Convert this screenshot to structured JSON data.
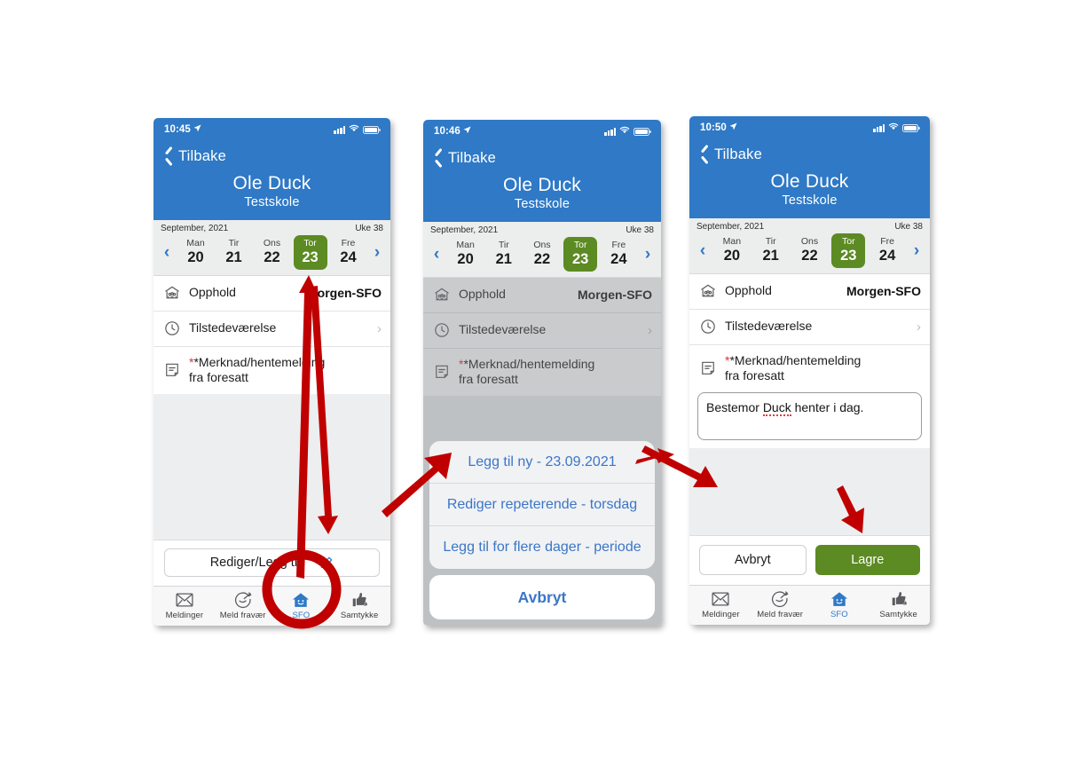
{
  "screens": [
    {
      "id": "screen-overview",
      "statusbar": {
        "time": "10:45",
        "location_icon": "location-arrow-icon",
        "signal_icon": "signal-bars-icon",
        "wifi_icon": "wifi-icon",
        "battery_icon": "battery-full-icon"
      },
      "header": {
        "back_label": "Tilbake",
        "back_icon": "chevron-left-icon",
        "title": "Ole Duck",
        "subtitle": "Testskole"
      },
      "datestrip": {
        "month_year": "September, 2021",
        "week": "Uke 38",
        "prev_icon": "chevron-left-icon",
        "next_icon": "chevron-right-icon",
        "days": [
          {
            "dow": "Man",
            "num": "20",
            "selected": false
          },
          {
            "dow": "Tir",
            "num": "21",
            "selected": false
          },
          {
            "dow": "Ons",
            "num": "22",
            "selected": false
          },
          {
            "dow": "Tor",
            "num": "23",
            "selected": true
          },
          {
            "dow": "Fre",
            "num": "24",
            "selected": false
          }
        ]
      },
      "rows": [
        {
          "icon": "school-building-icon",
          "label": "Opphold",
          "value": "Morgen-SFO",
          "chevron": false
        },
        {
          "icon": "clock-icon",
          "label": "Tilstedeværelse",
          "value": "",
          "chevron": true,
          "chevron_glyph": "›"
        },
        {
          "icon": "note-icon",
          "label": "*Merknad/hentemelding\nfra foresatt",
          "value": "",
          "chevron": false,
          "star": true
        }
      ],
      "edit_button": {
        "label": "Rediger/Legg til",
        "icon": "pencil-icon"
      },
      "tabs": [
        {
          "icon": "envelope-icon",
          "label": "Meldinger",
          "active": false
        },
        {
          "icon": "absence-icon",
          "label": "Meld fravær",
          "active": false
        },
        {
          "icon": "house-smile-icon",
          "label": "SFO",
          "active": true
        },
        {
          "icon": "thumbs-up-icon",
          "label": "Samtykke",
          "active": false
        }
      ]
    },
    {
      "id": "screen-actionsheet",
      "statusbar": {
        "time": "10:46",
        "location_icon": "location-arrow-icon",
        "signal_icon": "signal-bars-icon",
        "wifi_icon": "wifi-icon",
        "battery_icon": "battery-full-icon"
      },
      "header": {
        "back_label": "Tilbake",
        "back_icon": "chevron-left-icon",
        "title": "Ole Duck",
        "subtitle": "Testskole"
      },
      "datestrip": {
        "month_year": "September, 2021",
        "week": "Uke 38",
        "prev_icon": "chevron-left-icon",
        "next_icon": "chevron-right-icon",
        "days": [
          {
            "dow": "Man",
            "num": "20",
            "selected": false
          },
          {
            "dow": "Tir",
            "num": "21",
            "selected": false
          },
          {
            "dow": "Ons",
            "num": "22",
            "selected": false
          },
          {
            "dow": "Tor",
            "num": "23",
            "selected": true
          },
          {
            "dow": "Fre",
            "num": "24",
            "selected": false
          }
        ]
      },
      "rows": [
        {
          "icon": "school-building-icon",
          "label": "Opphold",
          "value": "Morgen-SFO",
          "chevron": false
        },
        {
          "icon": "clock-icon",
          "label": "Tilstedeværelse",
          "value": "",
          "chevron": true,
          "chevron_glyph": "›"
        },
        {
          "icon": "note-icon",
          "label": "*Merknad/hentemelding\nfra foresatt",
          "value": "",
          "chevron": false,
          "star": true
        }
      ],
      "action_sheet": {
        "options": [
          "Legg til ny - 23.09.2021",
          "Rediger repeterende - torsdag",
          "Legg til for flere dager - periode"
        ],
        "cancel": "Avbryt"
      }
    },
    {
      "id": "screen-edit-note",
      "statusbar": {
        "time": "10:50",
        "location_icon": "location-arrow-icon",
        "signal_icon": "signal-bars-icon",
        "wifi_icon": "wifi-icon",
        "battery_icon": "battery-full-icon"
      },
      "header": {
        "back_label": "Tilbake",
        "back_icon": "chevron-left-icon",
        "title": "Ole Duck",
        "subtitle": "Testskole"
      },
      "datestrip": {
        "month_year": "September, 2021",
        "week": "Uke 38",
        "prev_icon": "chevron-left-icon",
        "next_icon": "chevron-right-icon",
        "days": [
          {
            "dow": "Man",
            "num": "20",
            "selected": false
          },
          {
            "dow": "Tir",
            "num": "21",
            "selected": false
          },
          {
            "dow": "Ons",
            "num": "22",
            "selected": false
          },
          {
            "dow": "Tor",
            "num": "23",
            "selected": true
          },
          {
            "dow": "Fre",
            "num": "24",
            "selected": false
          }
        ]
      },
      "rows": [
        {
          "icon": "school-building-icon",
          "label": "Opphold",
          "value": "Morgen-SFO",
          "chevron": false
        },
        {
          "icon": "clock-icon",
          "label": "Tilstedeværelse",
          "value": "",
          "chevron": true,
          "chevron_glyph": "›"
        },
        {
          "icon": "note-icon",
          "label": "*Merknad/hentemelding\nfra foresatt",
          "value": "",
          "chevron": false,
          "star": true
        }
      ],
      "note_field": {
        "value_before": "Bestemor ",
        "value_misspelled": "Duck",
        "value_after": " henter i dag.",
        "full_value": "Bestemor Duck henter i dag."
      },
      "buttons": {
        "cancel": "Avbryt",
        "save": "Lagre"
      },
      "tabs": [
        {
          "icon": "envelope-icon",
          "label": "Meldinger",
          "active": false
        },
        {
          "icon": "absence-icon",
          "label": "Meld fravær",
          "active": false
        },
        {
          "icon": "house-smile-icon",
          "label": "SFO",
          "active": true
        },
        {
          "icon": "thumbs-up-icon",
          "label": "Samtykke",
          "active": false
        }
      ]
    }
  ],
  "annotations": {
    "arrow_color": "#c00000",
    "items": [
      {
        "name": "arrow-up-to-date",
        "desc": "arrow pointing up to selected date 23"
      },
      {
        "name": "arrow-down-to-edit-button",
        "desc": "arrow pointing down to Rediger/Legg til"
      },
      {
        "name": "circle-highlight-sfo-tab",
        "desc": "red circle around SFO tab"
      },
      {
        "name": "arrow-to-action-sheet",
        "desc": "diagonal arrow to Legg til ny option"
      },
      {
        "name": "arrow-right-at-option",
        "desc": "short arrow pointing left at Legg til ny"
      },
      {
        "name": "arrow-to-note-field",
        "desc": "arrow pointing to note input field"
      },
      {
        "name": "arrow-to-save-button",
        "desc": "arrow pointing down to Lagre button"
      }
    ]
  },
  "theme": {
    "brand_blue": "#2f79c6",
    "accent_green": "#5c8a23",
    "link_blue": "#3a76c8",
    "annotation_red": "#c00000",
    "page_bg": "#ffffff"
  }
}
